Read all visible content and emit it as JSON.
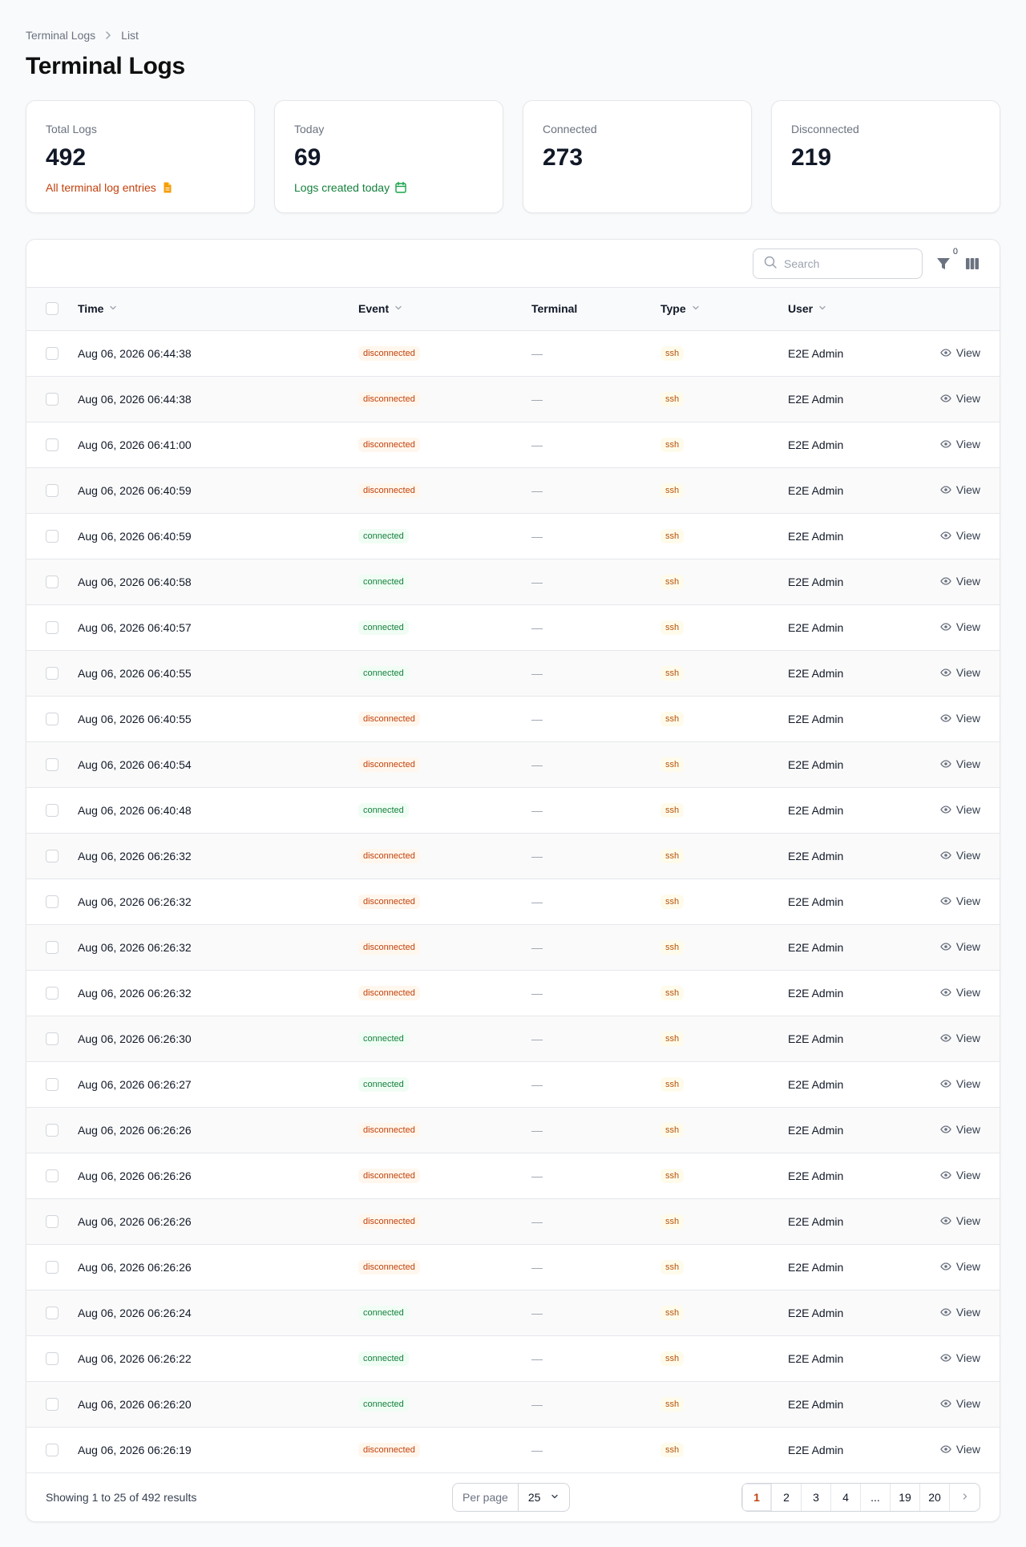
{
  "breadcrumb": {
    "root": "Terminal Logs",
    "current": "List"
  },
  "page_title": "Terminal Logs",
  "stats": [
    {
      "label": "Total Logs",
      "value": "492",
      "desc": "All terminal log entries",
      "desc_color": "#c2410c",
      "icon": "document-icon"
    },
    {
      "label": "Today",
      "value": "69",
      "desc": "Logs created today",
      "desc_color": "#15803d",
      "icon": "calendar-icon"
    },
    {
      "label": "Connected",
      "value": "273"
    },
    {
      "label": "Disconnected",
      "value": "219"
    }
  ],
  "toolbar": {
    "search_placeholder": "Search",
    "filter_count": "0"
  },
  "columns": {
    "time": "Time",
    "event": "Event",
    "terminal": "Terminal",
    "type": "Type",
    "user": "User"
  },
  "rows": [
    {
      "time": "Aug 06, 2026 06:44:38",
      "event": "disconnected",
      "terminal": "—",
      "type": "ssh",
      "user": "E2E Admin",
      "action": "View"
    },
    {
      "time": "Aug 06, 2026 06:44:38",
      "event": "disconnected",
      "terminal": "—",
      "type": "ssh",
      "user": "E2E Admin",
      "action": "View"
    },
    {
      "time": "Aug 06, 2026 06:41:00",
      "event": "disconnected",
      "terminal": "—",
      "type": "ssh",
      "user": "E2E Admin",
      "action": "View"
    },
    {
      "time": "Aug 06, 2026 06:40:59",
      "event": "disconnected",
      "terminal": "—",
      "type": "ssh",
      "user": "E2E Admin",
      "action": "View"
    },
    {
      "time": "Aug 06, 2026 06:40:59",
      "event": "connected",
      "terminal": "—",
      "type": "ssh",
      "user": "E2E Admin",
      "action": "View"
    },
    {
      "time": "Aug 06, 2026 06:40:58",
      "event": "connected",
      "terminal": "—",
      "type": "ssh",
      "user": "E2E Admin",
      "action": "View"
    },
    {
      "time": "Aug 06, 2026 06:40:57",
      "event": "connected",
      "terminal": "—",
      "type": "ssh",
      "user": "E2E Admin",
      "action": "View"
    },
    {
      "time": "Aug 06, 2026 06:40:55",
      "event": "connected",
      "terminal": "—",
      "type": "ssh",
      "user": "E2E Admin",
      "action": "View"
    },
    {
      "time": "Aug 06, 2026 06:40:55",
      "event": "disconnected",
      "terminal": "—",
      "type": "ssh",
      "user": "E2E Admin",
      "action": "View"
    },
    {
      "time": "Aug 06, 2026 06:40:54",
      "event": "disconnected",
      "terminal": "—",
      "type": "ssh",
      "user": "E2E Admin",
      "action": "View"
    },
    {
      "time": "Aug 06, 2026 06:40:48",
      "event": "connected",
      "terminal": "—",
      "type": "ssh",
      "user": "E2E Admin",
      "action": "View"
    },
    {
      "time": "Aug 06, 2026 06:26:32",
      "event": "disconnected",
      "terminal": "—",
      "type": "ssh",
      "user": "E2E Admin",
      "action": "View"
    },
    {
      "time": "Aug 06, 2026 06:26:32",
      "event": "disconnected",
      "terminal": "—",
      "type": "ssh",
      "user": "E2E Admin",
      "action": "View"
    },
    {
      "time": "Aug 06, 2026 06:26:32",
      "event": "disconnected",
      "terminal": "—",
      "type": "ssh",
      "user": "E2E Admin",
      "action": "View"
    },
    {
      "time": "Aug 06, 2026 06:26:32",
      "event": "disconnected",
      "terminal": "—",
      "type": "ssh",
      "user": "E2E Admin",
      "action": "View"
    },
    {
      "time": "Aug 06, 2026 06:26:30",
      "event": "connected",
      "terminal": "—",
      "type": "ssh",
      "user": "E2E Admin",
      "action": "View"
    },
    {
      "time": "Aug 06, 2026 06:26:27",
      "event": "connected",
      "terminal": "—",
      "type": "ssh",
      "user": "E2E Admin",
      "action": "View"
    },
    {
      "time": "Aug 06, 2026 06:26:26",
      "event": "disconnected",
      "terminal": "—",
      "type": "ssh",
      "user": "E2E Admin",
      "action": "View"
    },
    {
      "time": "Aug 06, 2026 06:26:26",
      "event": "disconnected",
      "terminal": "—",
      "type": "ssh",
      "user": "E2E Admin",
      "action": "View"
    },
    {
      "time": "Aug 06, 2026 06:26:26",
      "event": "disconnected",
      "terminal": "—",
      "type": "ssh",
      "user": "E2E Admin",
      "action": "View"
    },
    {
      "time": "Aug 06, 2026 06:26:26",
      "event": "disconnected",
      "terminal": "—",
      "type": "ssh",
      "user": "E2E Admin",
      "action": "View"
    },
    {
      "time": "Aug 06, 2026 06:26:24",
      "event": "connected",
      "terminal": "—",
      "type": "ssh",
      "user": "E2E Admin",
      "action": "View"
    },
    {
      "time": "Aug 06, 2026 06:26:22",
      "event": "connected",
      "terminal": "—",
      "type": "ssh",
      "user": "E2E Admin",
      "action": "View"
    },
    {
      "time": "Aug 06, 2026 06:26:20",
      "event": "connected",
      "terminal": "—",
      "type": "ssh",
      "user": "E2E Admin",
      "action": "View"
    },
    {
      "time": "Aug 06, 2026 06:26:19",
      "event": "disconnected",
      "terminal": "—",
      "type": "ssh",
      "user": "E2E Admin",
      "action": "View"
    }
  ],
  "footer": {
    "results_text": "Showing 1 to 25 of 492 results",
    "per_page_label": "Per page",
    "per_page_value": "25",
    "pages": [
      "1",
      "2",
      "3",
      "4",
      "...",
      "19",
      "20"
    ],
    "active_page": "1"
  },
  "colors": {
    "accent": "#c2410c",
    "success": "#15803d",
    "warning": "#b45309"
  }
}
